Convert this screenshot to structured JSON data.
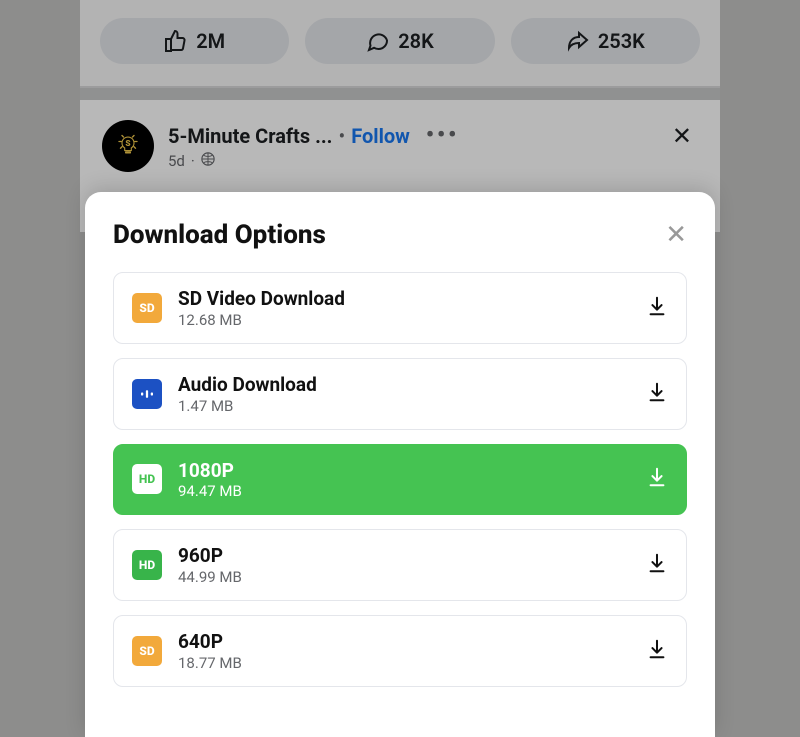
{
  "engagement": {
    "likes": "2M",
    "comments": "28K",
    "shares": "253K"
  },
  "post": {
    "page_name": "5-Minute Crafts ...",
    "follow_label": "Follow",
    "time": "5d"
  },
  "modal": {
    "title": "Download Options",
    "options": [
      {
        "badge_type": "sd",
        "badge_text": "SD",
        "label": "SD Video Download",
        "size": "12.68 MB",
        "selected": false
      },
      {
        "badge_type": "audio",
        "badge_text": "",
        "label": "Audio Download",
        "size": "1.47 MB",
        "selected": false
      },
      {
        "badge_type": "hd-white",
        "badge_text": "HD",
        "label": "1080P",
        "size": "94.47 MB",
        "selected": true
      },
      {
        "badge_type": "hd",
        "badge_text": "HD",
        "label": "960P",
        "size": "44.99 MB",
        "selected": false
      },
      {
        "badge_type": "sd",
        "badge_text": "SD",
        "label": "640P",
        "size": "18.77 MB",
        "selected": false
      }
    ]
  }
}
